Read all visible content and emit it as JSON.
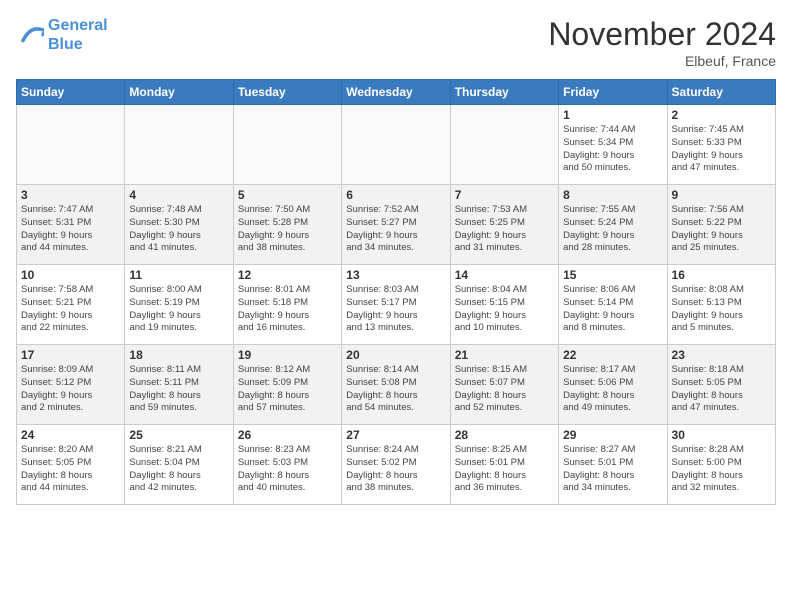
{
  "logo": {
    "line1": "General",
    "line2": "Blue"
  },
  "header": {
    "month": "November 2024",
    "location": "Elbeuf, France"
  },
  "weekdays": [
    "Sunday",
    "Monday",
    "Tuesday",
    "Wednesday",
    "Thursday",
    "Friday",
    "Saturday"
  ],
  "weeks": [
    [
      {
        "day": "",
        "info": ""
      },
      {
        "day": "",
        "info": ""
      },
      {
        "day": "",
        "info": ""
      },
      {
        "day": "",
        "info": ""
      },
      {
        "day": "",
        "info": ""
      },
      {
        "day": "1",
        "info": "Sunrise: 7:44 AM\nSunset: 5:34 PM\nDaylight: 9 hours\nand 50 minutes."
      },
      {
        "day": "2",
        "info": "Sunrise: 7:45 AM\nSunset: 5:33 PM\nDaylight: 9 hours\nand 47 minutes."
      }
    ],
    [
      {
        "day": "3",
        "info": "Sunrise: 7:47 AM\nSunset: 5:31 PM\nDaylight: 9 hours\nand 44 minutes."
      },
      {
        "day": "4",
        "info": "Sunrise: 7:48 AM\nSunset: 5:30 PM\nDaylight: 9 hours\nand 41 minutes."
      },
      {
        "day": "5",
        "info": "Sunrise: 7:50 AM\nSunset: 5:28 PM\nDaylight: 9 hours\nand 38 minutes."
      },
      {
        "day": "6",
        "info": "Sunrise: 7:52 AM\nSunset: 5:27 PM\nDaylight: 9 hours\nand 34 minutes."
      },
      {
        "day": "7",
        "info": "Sunrise: 7:53 AM\nSunset: 5:25 PM\nDaylight: 9 hours\nand 31 minutes."
      },
      {
        "day": "8",
        "info": "Sunrise: 7:55 AM\nSunset: 5:24 PM\nDaylight: 9 hours\nand 28 minutes."
      },
      {
        "day": "9",
        "info": "Sunrise: 7:56 AM\nSunset: 5:22 PM\nDaylight: 9 hours\nand 25 minutes."
      }
    ],
    [
      {
        "day": "10",
        "info": "Sunrise: 7:58 AM\nSunset: 5:21 PM\nDaylight: 9 hours\nand 22 minutes."
      },
      {
        "day": "11",
        "info": "Sunrise: 8:00 AM\nSunset: 5:19 PM\nDaylight: 9 hours\nand 19 minutes."
      },
      {
        "day": "12",
        "info": "Sunrise: 8:01 AM\nSunset: 5:18 PM\nDaylight: 9 hours\nand 16 minutes."
      },
      {
        "day": "13",
        "info": "Sunrise: 8:03 AM\nSunset: 5:17 PM\nDaylight: 9 hours\nand 13 minutes."
      },
      {
        "day": "14",
        "info": "Sunrise: 8:04 AM\nSunset: 5:15 PM\nDaylight: 9 hours\nand 10 minutes."
      },
      {
        "day": "15",
        "info": "Sunrise: 8:06 AM\nSunset: 5:14 PM\nDaylight: 9 hours\nand 8 minutes."
      },
      {
        "day": "16",
        "info": "Sunrise: 8:08 AM\nSunset: 5:13 PM\nDaylight: 9 hours\nand 5 minutes."
      }
    ],
    [
      {
        "day": "17",
        "info": "Sunrise: 8:09 AM\nSunset: 5:12 PM\nDaylight: 9 hours\nand 2 minutes."
      },
      {
        "day": "18",
        "info": "Sunrise: 8:11 AM\nSunset: 5:11 PM\nDaylight: 8 hours\nand 59 minutes."
      },
      {
        "day": "19",
        "info": "Sunrise: 8:12 AM\nSunset: 5:09 PM\nDaylight: 8 hours\nand 57 minutes."
      },
      {
        "day": "20",
        "info": "Sunrise: 8:14 AM\nSunset: 5:08 PM\nDaylight: 8 hours\nand 54 minutes."
      },
      {
        "day": "21",
        "info": "Sunrise: 8:15 AM\nSunset: 5:07 PM\nDaylight: 8 hours\nand 52 minutes."
      },
      {
        "day": "22",
        "info": "Sunrise: 8:17 AM\nSunset: 5:06 PM\nDaylight: 8 hours\nand 49 minutes."
      },
      {
        "day": "23",
        "info": "Sunrise: 8:18 AM\nSunset: 5:05 PM\nDaylight: 8 hours\nand 47 minutes."
      }
    ],
    [
      {
        "day": "24",
        "info": "Sunrise: 8:20 AM\nSunset: 5:05 PM\nDaylight: 8 hours\nand 44 minutes."
      },
      {
        "day": "25",
        "info": "Sunrise: 8:21 AM\nSunset: 5:04 PM\nDaylight: 8 hours\nand 42 minutes."
      },
      {
        "day": "26",
        "info": "Sunrise: 8:23 AM\nSunset: 5:03 PM\nDaylight: 8 hours\nand 40 minutes."
      },
      {
        "day": "27",
        "info": "Sunrise: 8:24 AM\nSunset: 5:02 PM\nDaylight: 8 hours\nand 38 minutes."
      },
      {
        "day": "28",
        "info": "Sunrise: 8:25 AM\nSunset: 5:01 PM\nDaylight: 8 hours\nand 36 minutes."
      },
      {
        "day": "29",
        "info": "Sunrise: 8:27 AM\nSunset: 5:01 PM\nDaylight: 8 hours\nand 34 minutes."
      },
      {
        "day": "30",
        "info": "Sunrise: 8:28 AM\nSunset: 5:00 PM\nDaylight: 8 hours\nand 32 minutes."
      }
    ]
  ]
}
